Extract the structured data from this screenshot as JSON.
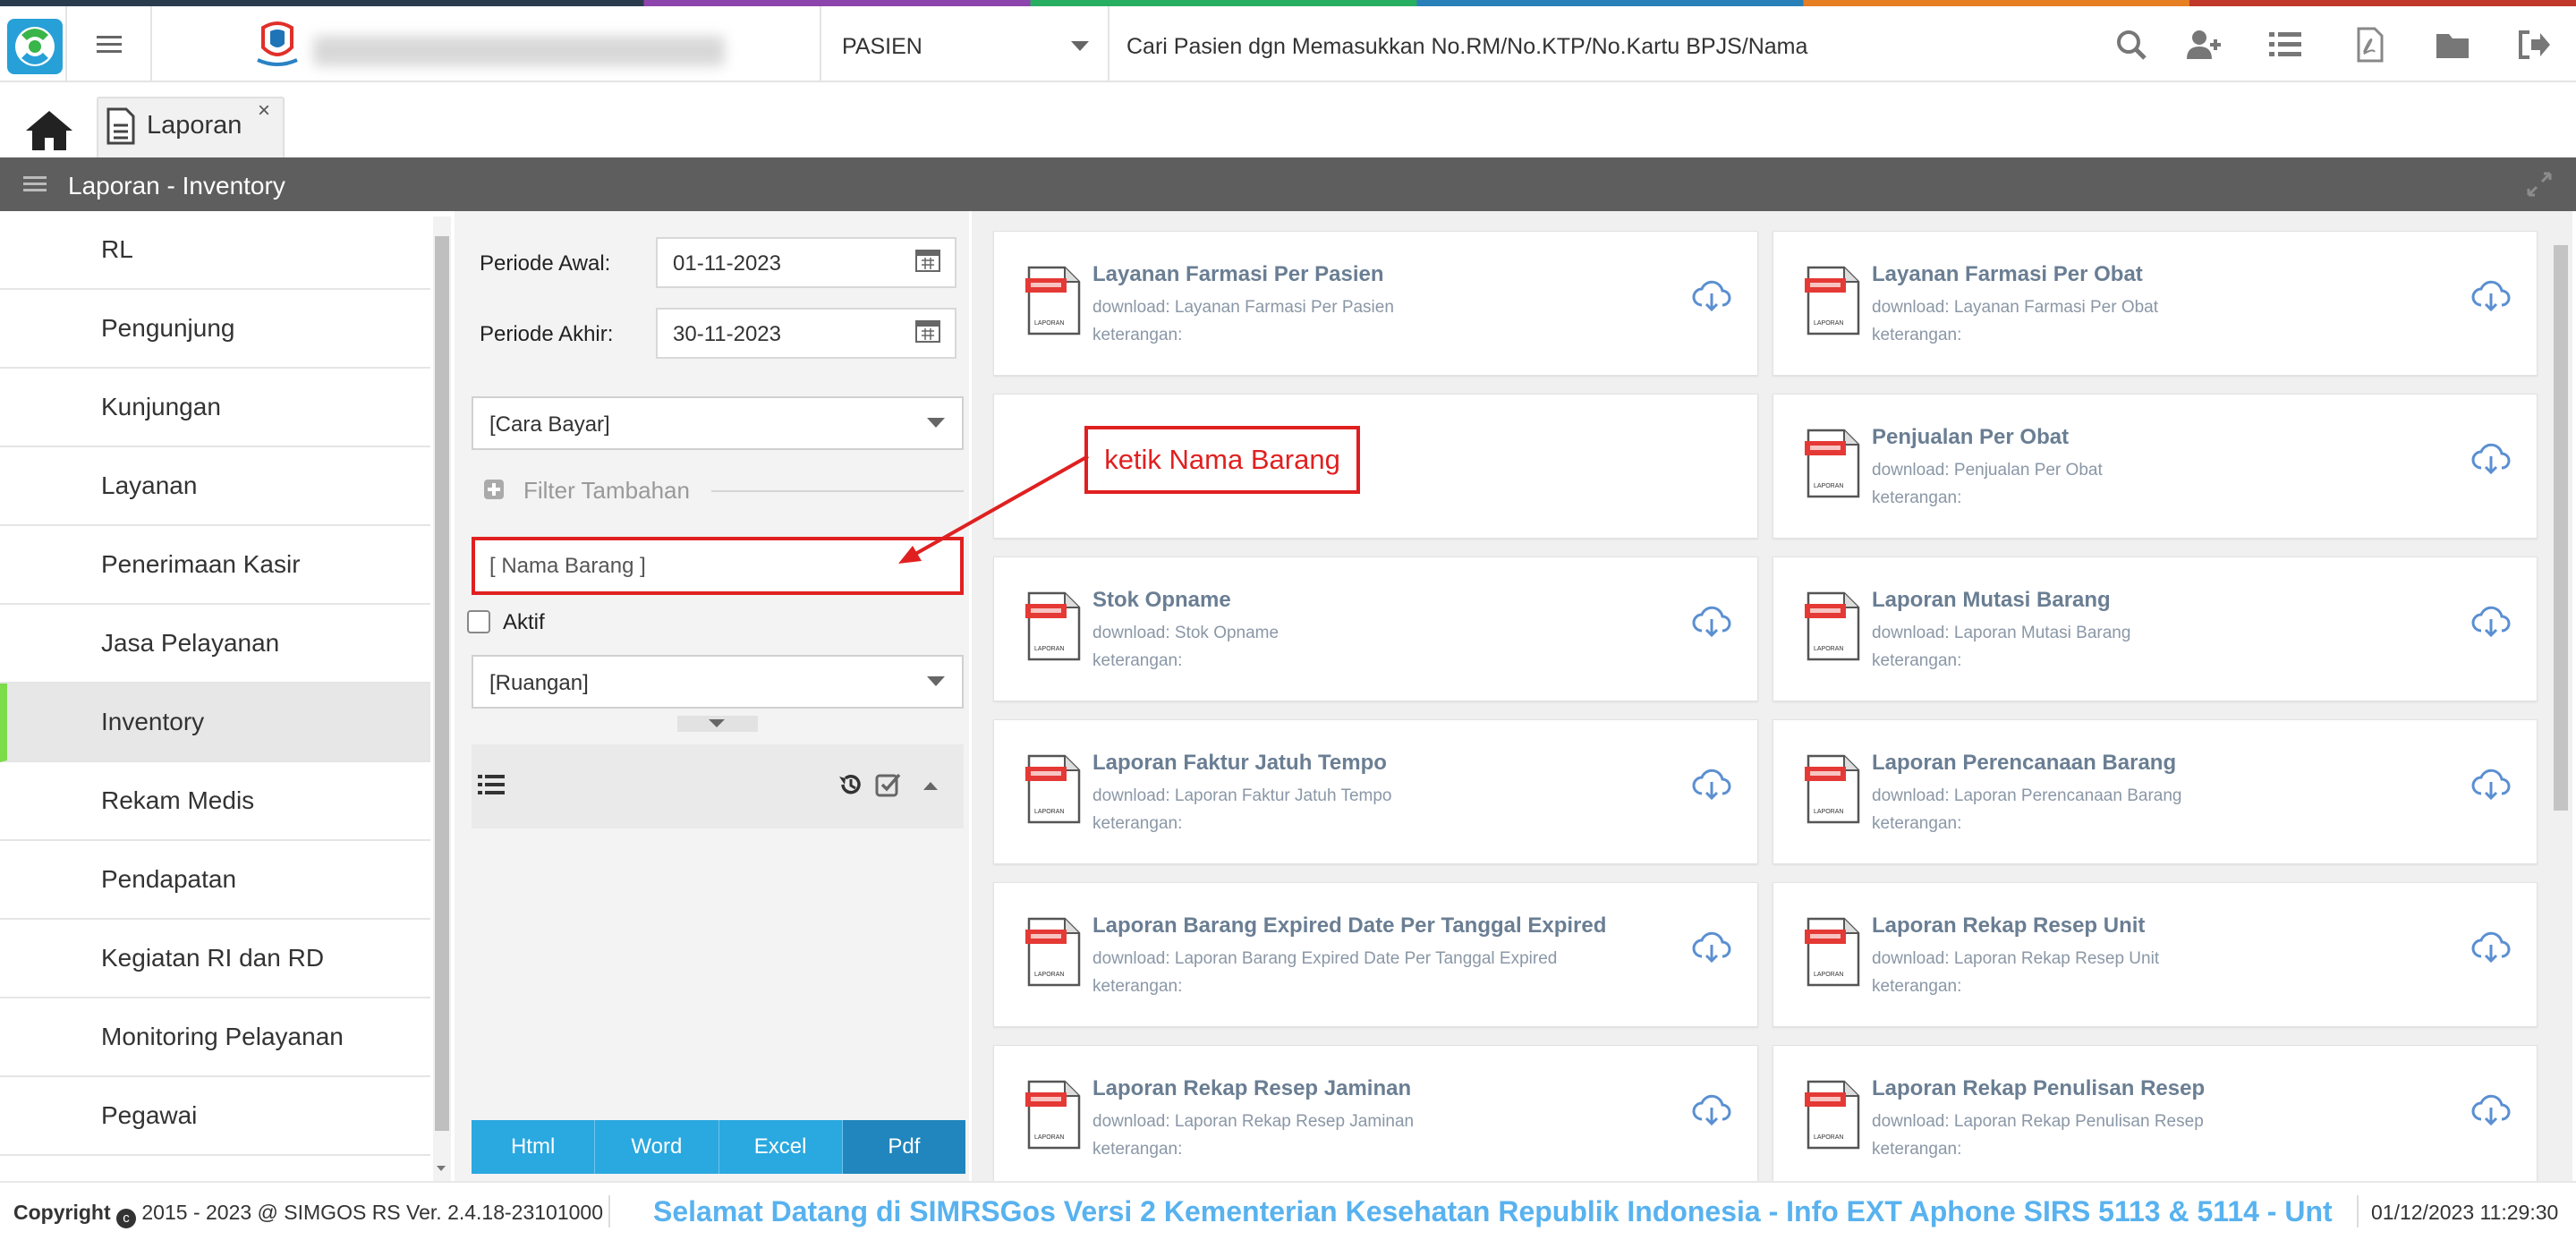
{
  "header": {
    "module_select": "PASIEN",
    "search_placeholder": "Cari Pasien dgn Memasukkan No.RM/No.KTP/No.Kartu BPJS/Nama"
  },
  "tabs": [
    {
      "label": "Laporan",
      "close": "×"
    }
  ],
  "panel": {
    "title": "Laporan - Inventory"
  },
  "sidebar": {
    "items": [
      {
        "label": "RL"
      },
      {
        "label": "Pengunjung"
      },
      {
        "label": "Kunjungan"
      },
      {
        "label": "Layanan"
      },
      {
        "label": "Penerimaan Kasir"
      },
      {
        "label": "Jasa Pelayanan"
      },
      {
        "label": "Inventory",
        "active": true
      },
      {
        "label": "Rekam Medis"
      },
      {
        "label": "Pendapatan"
      },
      {
        "label": "Kegiatan RI dan RD"
      },
      {
        "label": "Monitoring Pelayanan"
      },
      {
        "label": "Pegawai"
      }
    ]
  },
  "filters": {
    "periode_awal_label": "Periode Awal:",
    "periode_awal_value": "01-11-2023",
    "periode_akhir_label": "Periode Akhir:",
    "periode_akhir_value": "30-11-2023",
    "cara_bayar": "[Cara Bayar]",
    "filter_tambahan": "Filter Tambahan",
    "nama_barang_placeholder": "[ Nama Barang ]",
    "aktif_label": "Aktif",
    "ruangan": "[Ruangan]"
  },
  "export_buttons": [
    "Html",
    "Word",
    "Excel",
    "Pdf"
  ],
  "annotation": {
    "text": "ketik Nama Barang"
  },
  "reports": [
    {
      "title": "Layanan Farmasi Per Pasien",
      "download": "download: Layanan Farmasi Per Pasien",
      "keterangan": "keterangan:"
    },
    {
      "title": "Layanan Farmasi Per Obat",
      "download": "download: Layanan Farmasi Per Obat",
      "keterangan": "keterangan:"
    },
    {
      "title": "",
      "download": "",
      "keterangan": ""
    },
    {
      "title": "Penjualan Per Obat",
      "download": "download: Penjualan Per Obat",
      "keterangan": "keterangan:"
    },
    {
      "title": "Stok Opname",
      "download": "download: Stok Opname",
      "keterangan": "keterangan:"
    },
    {
      "title": "Laporan Mutasi Barang",
      "download": "download: Laporan Mutasi Barang",
      "keterangan": "keterangan:"
    },
    {
      "title": "Laporan Faktur Jatuh Tempo",
      "download": "download: Laporan Faktur Jatuh Tempo",
      "keterangan": "keterangan:"
    },
    {
      "title": "Laporan Perencanaan Barang",
      "download": "download: Laporan Perencanaan Barang",
      "keterangan": "keterangan:"
    },
    {
      "title": "Laporan Barang Expired Date Per Tanggal Expired",
      "download": "download: Laporan Barang Expired Date Per Tanggal Expired",
      "keterangan": "keterangan:"
    },
    {
      "title": "Laporan Rekap Resep Unit",
      "download": "download: Laporan Rekap Resep Unit",
      "keterangan": "keterangan:"
    },
    {
      "title": "Laporan Rekap Resep Jaminan",
      "download": "download: Laporan Rekap Resep Jaminan",
      "keterangan": "keterangan:"
    },
    {
      "title": "Laporan Rekap Penulisan Resep",
      "download": "download: Laporan Rekap Penulisan Resep",
      "keterangan": "keterangan:"
    }
  ],
  "icon_label": "LAPORAN",
  "footer": {
    "copyright_label": "Copyright",
    "copyright_rest": "2015 - 2023 @ SIMGOS RS Ver. 2.4.18-23101000",
    "marquee": "Selamat Datang di SIMRSGos Versi 2 Kementerian Kesehatan Republik Indonesia - Info EXT Aphone SIRS 5113 & 5114 - Unt",
    "datetime": "01/12/2023 11:29:30"
  },
  "colors": {
    "accent": "#2aa8e0",
    "accent_dark": "#2086bd",
    "annotation": "#e02020",
    "sidebar_active": "#7ddc4a",
    "panel_header": "#5e5e5e"
  }
}
